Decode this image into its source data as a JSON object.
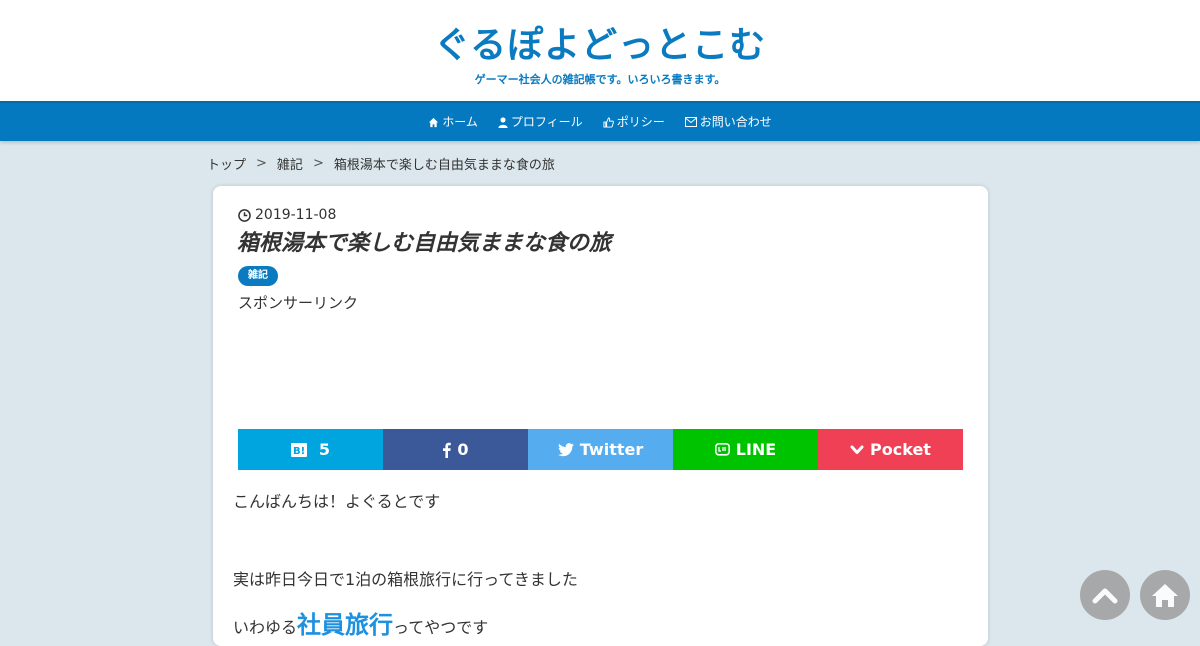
{
  "header": {
    "site_title": "ぐるぽよどっとこむ",
    "site_description": "ゲーマー社会人の雑記帳です。いろいろ書きます。"
  },
  "nav": {
    "items": [
      {
        "label": "ホーム",
        "icon": "home-icon"
      },
      {
        "label": "プロフィール",
        "icon": "user-icon"
      },
      {
        "label": "ポリシー",
        "icon": "thumbs-up-icon"
      },
      {
        "label": "お問い合わせ",
        "icon": "envelope-icon"
      }
    ]
  },
  "breadcrumb": {
    "items": [
      "トップ",
      "雑記",
      "箱根湯本で楽しむ自由気ままな食の旅"
    ],
    "separator": ">"
  },
  "post": {
    "date": "2019-11-08",
    "title": "箱根湯本で楽しむ自由気ままな食の旅",
    "category": "雑記",
    "sponsor_label": "スポンサーリンク",
    "paragraphs": [
      "こんばんちは！よぐるとです",
      "実は昨日今日で1泊の箱根旅行に行ってきました"
    ],
    "partial_line": {
      "prefix": "いわゆる",
      "link": "社員旅行",
      "suffix": "ってやつです"
    }
  },
  "share": {
    "hatena": {
      "icon": "hatena-icon",
      "label": "5",
      "color": "#00a4de"
    },
    "facebook": {
      "icon": "facebook-icon",
      "label": "0",
      "color": "#3b5998"
    },
    "twitter": {
      "icon": "twitter-icon",
      "label": "Twitter",
      "color": "#55acee"
    },
    "line": {
      "icon": "line-icon",
      "label": "LINE",
      "color": "#00c300"
    },
    "pocket": {
      "icon": "pocket-icon",
      "label": "Pocket",
      "color": "#ef4056"
    }
  },
  "floating": {
    "scroll_top_icon": "chevron-up-icon",
    "home_icon": "home-icon"
  },
  "colors": {
    "accent": "#0a7bc0",
    "nav_bg": "#0579c0",
    "page_bg": "#dbe7ec"
  }
}
